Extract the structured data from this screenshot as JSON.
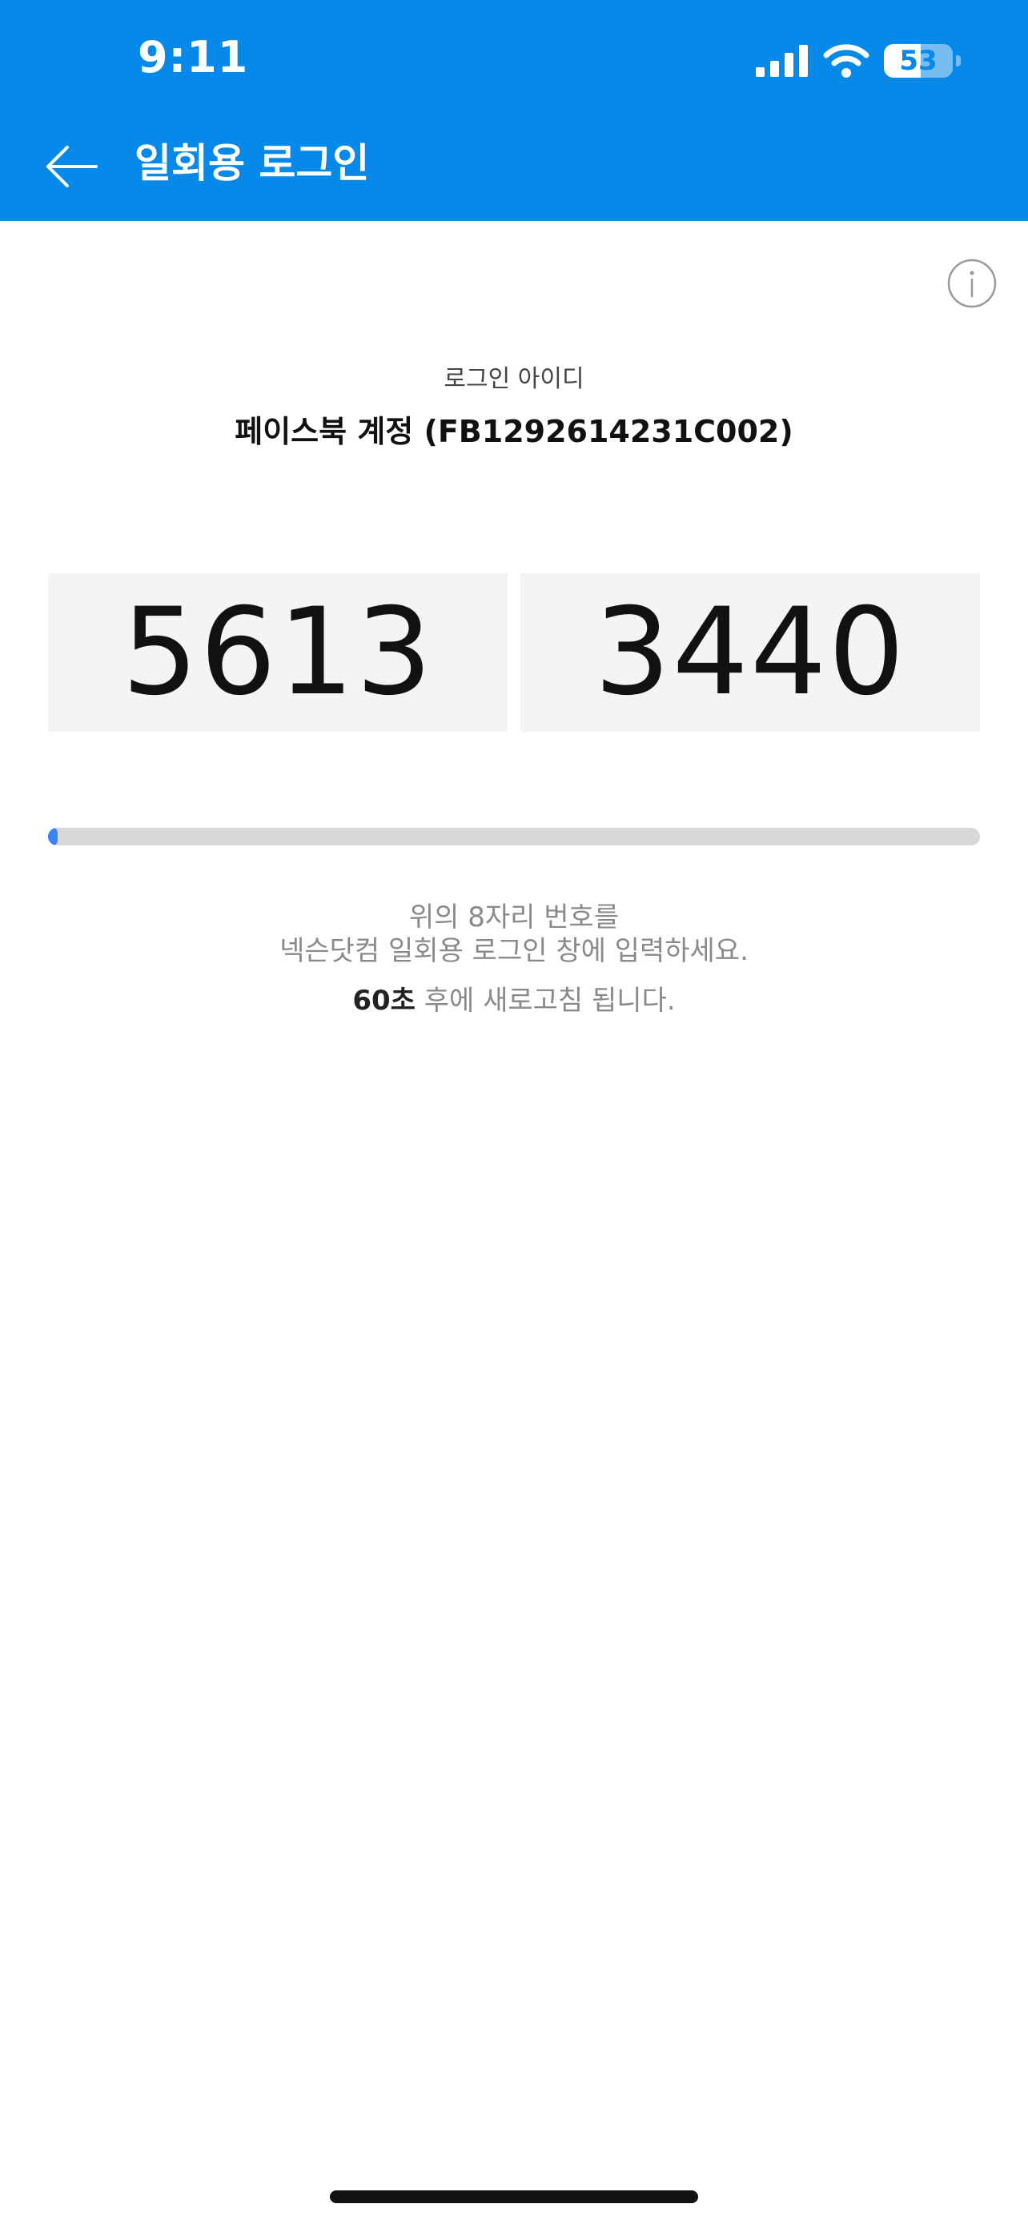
{
  "status_bar": {
    "time": "9:11",
    "battery_level": "53",
    "battery_fraction": 0.53
  },
  "header": {
    "title": "일회용 로그인"
  },
  "account": {
    "label": "로그인 아이디",
    "value": "페이스북 계정 (FB1292614231C002)"
  },
  "code": {
    "part1": "5613",
    "part2": "3440"
  },
  "timer": {
    "progress_fraction": 0.01,
    "seconds": "60초",
    "refresh_suffix": " 후에 새로고침 됩니다."
  },
  "instructions": {
    "line1": "위의 8자리 번호를",
    "line2": "넥슨닷컴 일회용 로그인 창에 입력하세요."
  },
  "colors": {
    "header_bg": "#0689e8",
    "progress_fill": "#3b82f6",
    "progress_track": "#d8d8d8",
    "code_box_bg": "#f4f4f4"
  },
  "icons": {
    "back": "arrow-left-icon",
    "info": "info-circle-icon",
    "signal": "cellular-signal-icon",
    "wifi": "wifi-icon",
    "battery": "battery-icon"
  }
}
